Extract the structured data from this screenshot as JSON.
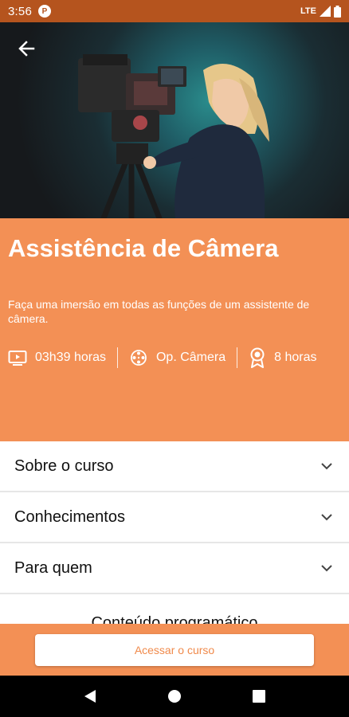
{
  "status_bar": {
    "time": "3:56",
    "app_badge": "P",
    "network": "LTE"
  },
  "hero": {
    "image_subject": "camera-operator-photo",
    "back_icon": "arrow-left-icon"
  },
  "course": {
    "title": "Assistência de Câmera",
    "description": "Faça uma imersão em todas as funções de um assistente de câmera.",
    "meta": {
      "duration": "03h39 horas",
      "category": "Op. Câmera",
      "certificate": "8 horas"
    }
  },
  "accordion": {
    "items": [
      {
        "label": "Sobre o curso"
      },
      {
        "label": "Conhecimentos"
      },
      {
        "label": "Para quem"
      }
    ],
    "partial_label": "Conteúdo programático"
  },
  "cta": {
    "label": "Acessar o curso"
  },
  "colors": {
    "accent": "#f39055",
    "status_bar": "#b5541e",
    "cta_text": "#f08a4b"
  }
}
